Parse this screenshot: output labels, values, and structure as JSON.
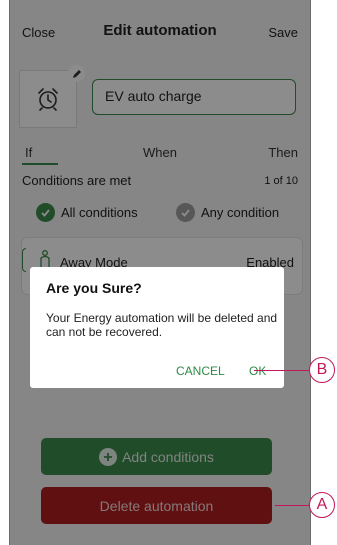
{
  "header": {
    "close_label": "Close",
    "title": "Edit automation",
    "save_label": "Save"
  },
  "automation": {
    "name": "EV auto charge",
    "icon": "alarm-clock-icon"
  },
  "tabs": [
    {
      "label": "If",
      "active": true
    },
    {
      "label": "When",
      "active": false
    },
    {
      "label": "Then",
      "active": false
    }
  ],
  "conditions": {
    "label": "Conditions are met",
    "count": "1 of 10",
    "options": [
      {
        "label": "All conditions",
        "selected": true
      },
      {
        "label": "Any condition",
        "selected": false
      }
    ],
    "items": [
      {
        "name": "Away Mode",
        "value": "Enabled",
        "icon": "person-icon"
      }
    ]
  },
  "buttons": {
    "add_conditions": "Add conditions",
    "delete_automation": "Delete automation"
  },
  "dialog": {
    "title": "Are you Sure?",
    "message": "Your Energy automation will be deleted and can not be recovered.",
    "cancel_label": "CANCEL",
    "ok_label": "OK"
  },
  "callouts": {
    "a": "A",
    "b": "B"
  },
  "colors": {
    "accent_green": "#3c8a4b",
    "danger_red": "#b01e20",
    "callout": "#c2185b"
  }
}
